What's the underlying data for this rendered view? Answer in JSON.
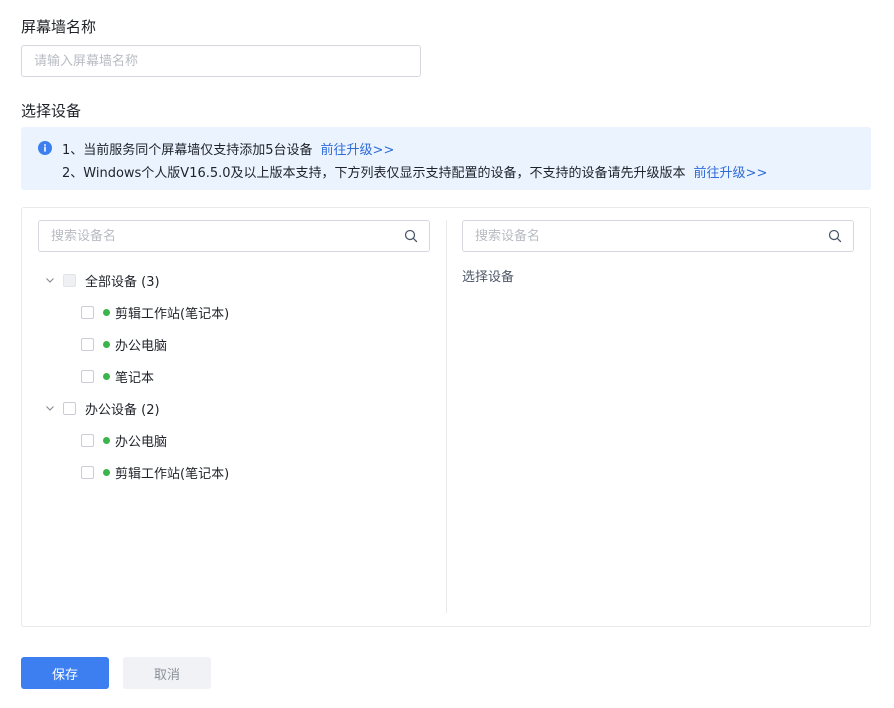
{
  "form": {
    "name_label": "屏幕墙名称",
    "name_placeholder": "请输入屏幕墙名称",
    "device_label": "选择设备"
  },
  "notice": {
    "line1": "1、当前服务同个屏幕墙仅支持添加5台设备",
    "line1_link": "前往升级>>",
    "line2": "2、Windows个人版V16.5.0及以上版本支持，下方列表仅显示支持配置的设备，不支持的设备请先升级版本",
    "line2_link": "前往升级>>",
    "icon": "info-icon",
    "accent_color": "#3d7ff0"
  },
  "left_panel": {
    "search_placeholder": "搜索设备名",
    "groups": [
      {
        "label": "全部设备 (3)",
        "items": [
          "剪辑工作站(笔记本)",
          "办公电脑",
          "笔记本"
        ]
      },
      {
        "label": "办公设备 (2)",
        "items": [
          "办公电脑",
          "剪辑工作站(笔记本)"
        ]
      }
    ],
    "online_color": "#3bb54a"
  },
  "right_panel": {
    "search_placeholder": "搜索设备名",
    "title": "选择设备"
  },
  "buttons": {
    "save": "保存",
    "cancel": "取消",
    "primary_color": "#3d7ff0"
  }
}
